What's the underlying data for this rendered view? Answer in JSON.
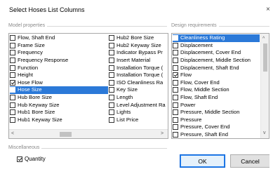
{
  "window": {
    "title": "Select Hoses List Columns",
    "close_glyph": "×"
  },
  "model_properties": {
    "title": "Model properties",
    "column1": [
      {
        "label": "Flow, Shaft End",
        "checked": false,
        "selected": false
      },
      {
        "label": "Frame Size",
        "checked": false,
        "selected": false
      },
      {
        "label": "Frequency",
        "checked": false,
        "selected": false
      },
      {
        "label": "Frequency Response",
        "checked": false,
        "selected": false
      },
      {
        "label": "Function",
        "checked": false,
        "selected": false
      },
      {
        "label": "Height",
        "checked": false,
        "selected": false
      },
      {
        "label": "Hose Flow",
        "checked": true,
        "selected": false
      },
      {
        "label": "Hose Size",
        "checked": true,
        "selected": true
      },
      {
        "label": "Hub Bore Size",
        "checked": false,
        "selected": false
      },
      {
        "label": "Hub Keyway Size",
        "checked": false,
        "selected": false
      },
      {
        "label": "Hub1 Bore Size",
        "checked": false,
        "selected": false
      },
      {
        "label": "Hub1 Keyway Size",
        "checked": false,
        "selected": false
      }
    ],
    "column2": [
      {
        "label": "Hub2 Bore Size",
        "checked": false,
        "selected": false
      },
      {
        "label": "Hub2 Keyway Size",
        "checked": false,
        "selected": false
      },
      {
        "label": "Indicator Bypass Pr",
        "checked": false,
        "selected": false
      },
      {
        "label": "Insert Material",
        "checked": false,
        "selected": false
      },
      {
        "label": "Installation Torque (",
        "checked": false,
        "selected": false
      },
      {
        "label": "Installation Torque (",
        "checked": false,
        "selected": false
      },
      {
        "label": "ISO Cleanliness Ra",
        "checked": false,
        "selected": false
      },
      {
        "label": "Key Size",
        "checked": false,
        "selected": false
      },
      {
        "label": "Length",
        "checked": false,
        "selected": false
      },
      {
        "label": "Level Adjustment Ra",
        "checked": false,
        "selected": false
      },
      {
        "label": "Lights",
        "checked": false,
        "selected": false
      },
      {
        "label": "List Price",
        "checked": false,
        "selected": false
      }
    ],
    "scroll_left": "<",
    "scroll_right": ">"
  },
  "design_requirements": {
    "title": "Design requirements",
    "items": [
      {
        "label": "Cleanliness Rating",
        "checked": false,
        "selected": true
      },
      {
        "label": "Displacement",
        "checked": false,
        "selected": false
      },
      {
        "label": "Displacement, Cover End",
        "checked": false,
        "selected": false
      },
      {
        "label": "Displacement, Middle Section",
        "checked": false,
        "selected": false
      },
      {
        "label": "Displacement, Shaft End",
        "checked": false,
        "selected": false
      },
      {
        "label": "Flow",
        "checked": true,
        "selected": false
      },
      {
        "label": "Flow, Cover End",
        "checked": false,
        "selected": false
      },
      {
        "label": "Flow, Middle Section",
        "checked": false,
        "selected": false
      },
      {
        "label": "Flow, Shaft End",
        "checked": false,
        "selected": false
      },
      {
        "label": "Power",
        "checked": false,
        "selected": false
      },
      {
        "label": "Pressure, Middle Section",
        "checked": false,
        "selected": false
      },
      {
        "label": "Pressure",
        "checked": false,
        "selected": false
      },
      {
        "label": "Pressure, Cover End",
        "checked": false,
        "selected": false
      },
      {
        "label": "Pressure, Shaft End",
        "checked": false,
        "selected": false
      }
    ],
    "scroll_up": "^",
    "scroll_down": "v"
  },
  "miscellaneous": {
    "title": "Miscellaneous",
    "quantity_label": "Quantity",
    "quantity_checked": true
  },
  "buttons": {
    "ok": "OK",
    "cancel": "Cancel"
  },
  "colors": {
    "selection": "#2b79d8",
    "default_button_border": "#0a64d8"
  }
}
